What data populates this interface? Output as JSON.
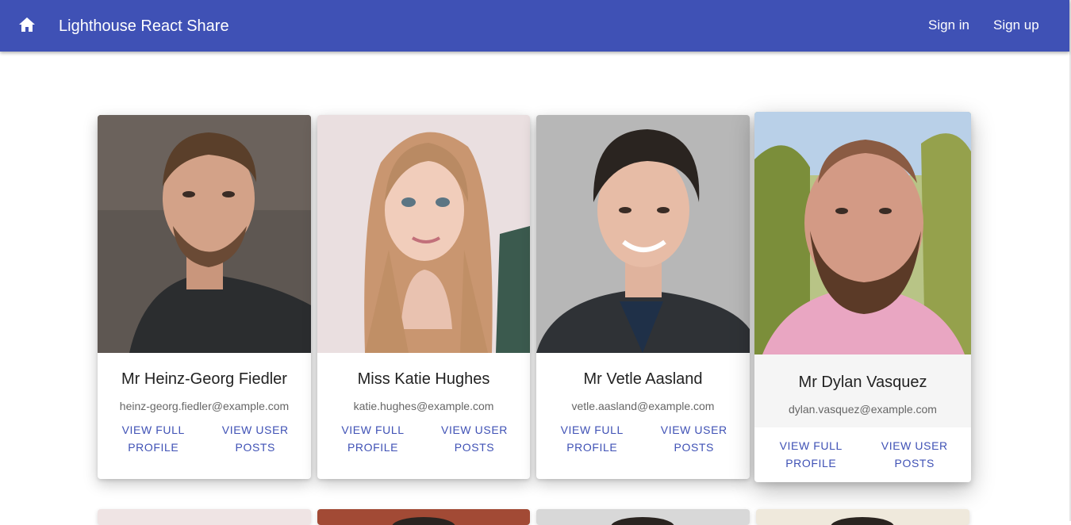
{
  "app": {
    "title": "Lighthouse React Share",
    "home_icon": "home-icon",
    "sign_in": "Sign in",
    "sign_up": "Sign up",
    "brand_color": "#3f51b5"
  },
  "users": [
    {
      "name": "Mr Heinz-Georg Fiedler",
      "email": "heinz-georg.fiedler@example.com",
      "view_profile": "VIEW FULL PROFILE",
      "view_posts": "VIEW USER POSTS"
    },
    {
      "name": "Miss Katie Hughes",
      "email": "katie.hughes@example.com",
      "view_profile": "VIEW FULL PROFILE",
      "view_posts": "VIEW USER POSTS"
    },
    {
      "name": "Mr Vetle Aasland",
      "email": "vetle.aasland@example.com",
      "view_profile": "VIEW FULL PROFILE",
      "view_posts": "VIEW USER POSTS"
    },
    {
      "name": "Mr Dylan Vasquez",
      "email": "dylan.vasquez@example.com",
      "view_profile": "VIEW FULL PROFILE",
      "view_posts": "VIEW USER POSTS"
    }
  ]
}
